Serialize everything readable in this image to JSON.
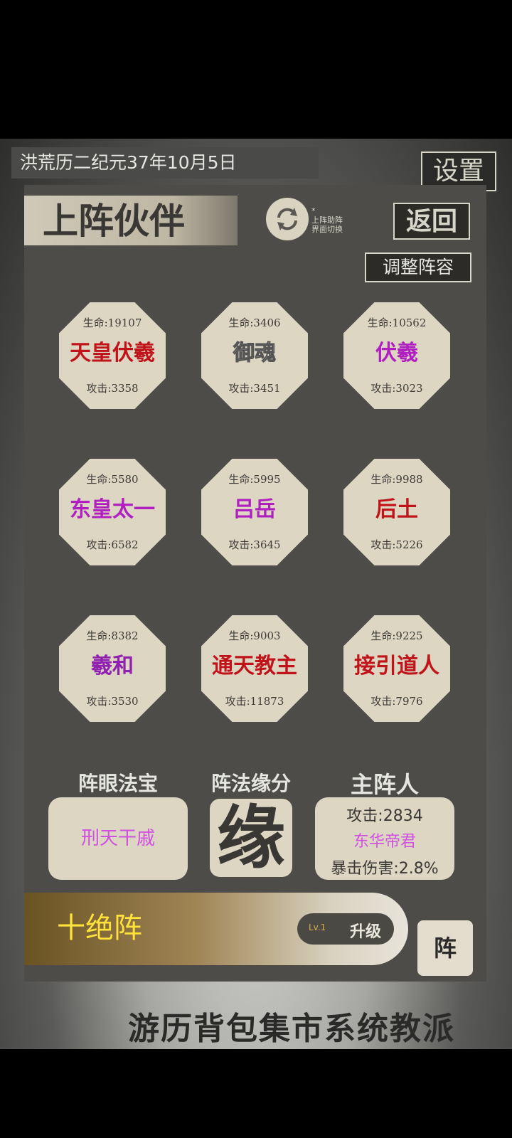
{
  "header": {
    "date": "洪荒历二纪元37年10月5日",
    "settings_label": "设置"
  },
  "bottom_nav": {
    "labels": "游历背包集市系统教派"
  },
  "panel": {
    "title": "上阵伙伴",
    "refresh_note_star": "*",
    "refresh_note_line1": "上阵助阵",
    "refresh_note_line2": "界面切换",
    "back_label": "返回",
    "adjust_label": "调整阵容"
  },
  "cards": [
    {
      "hp": "生命:19107",
      "name": "天皇伏羲",
      "atk": "攻击:3358",
      "color": "#c0141a"
    },
    {
      "hp": "生命:3406",
      "name": "御魂",
      "atk": "攻击:3451",
      "color": "#ffffff"
    },
    {
      "hp": "生命:10562",
      "name": "伏羲",
      "atk": "攻击:3023",
      "color": "#b020c0"
    },
    {
      "hp": "生命:5580",
      "name": "东皇太一",
      "atk": "攻击:6582",
      "color": "#b020c0"
    },
    {
      "hp": "生命:5995",
      "name": "吕岳",
      "atk": "攻击:3645",
      "color": "#b020c0"
    },
    {
      "hp": "生命:9988",
      "name": "后土",
      "atk": "攻击:5226",
      "color": "#c0141a"
    },
    {
      "hp": "生命:8382",
      "name": "羲和",
      "atk": "攻击:3530",
      "color": "#9020b0"
    },
    {
      "hp": "生命:9003",
      "name": "通天教主",
      "atk": "攻击:11873",
      "color": "#c0141a"
    },
    {
      "hp": "生命:9225",
      "name": "接引道人",
      "atk": "攻击:7976",
      "color": "#c0141a"
    }
  ],
  "treasure": {
    "label": "阵眼法宝",
    "value": "刑天干戚"
  },
  "fate": {
    "label": "阵法缘分",
    "glyph": "缘"
  },
  "lord": {
    "label": "主阵人",
    "attack": "攻击:2834",
    "name": "东华帝君",
    "crit": "暴击伤害:2.8%"
  },
  "formation": {
    "name": "十绝阵",
    "level": "Lv.1",
    "upgrade_label": "升级",
    "zhen_label": "阵"
  }
}
